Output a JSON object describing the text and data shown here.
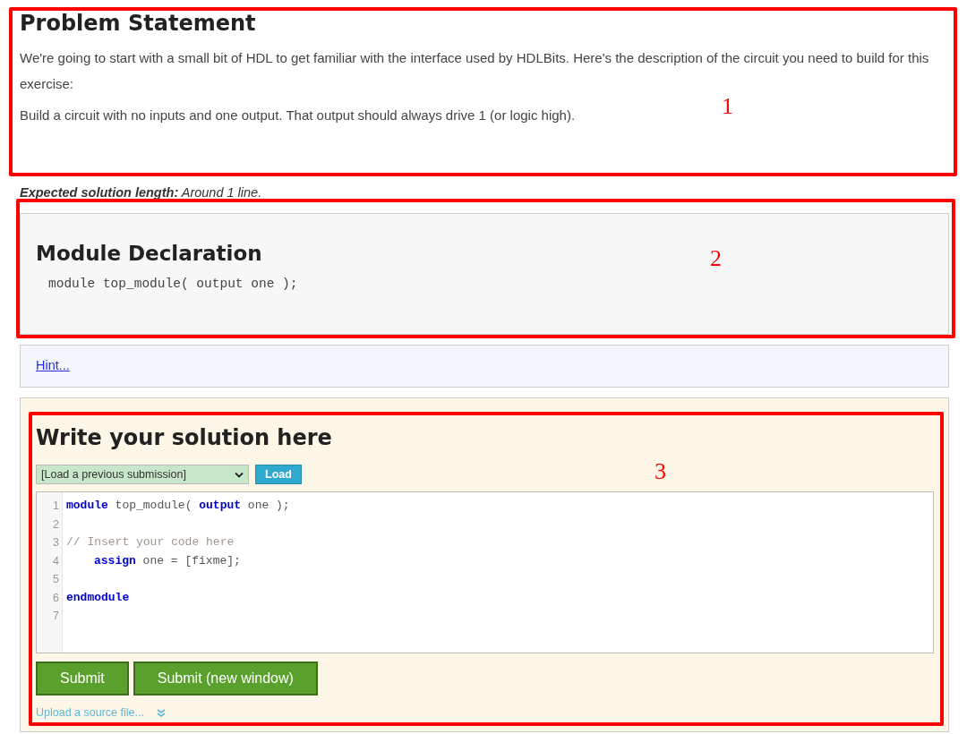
{
  "problem": {
    "title": "Problem Statement",
    "paragraphs": [
      "We're going to start with a small bit of HDL to get familiar with the interface used by HDLBits. Here's the description of the circuit you need to build for this exercise:",
      "Build a circuit with no inputs and one output. That output should always drive 1 (or logic high)."
    ]
  },
  "expected_length": "**Expected solution length:** Around 1 line.",
  "module_declaration": {
    "title": "Module Declaration",
    "code": "module top_module( output one );"
  },
  "hint": {
    "link": "Hint..."
  },
  "solution": {
    "title": "Write your solution here",
    "submission_select": "[Load a previous submission]",
    "load_button": "Load",
    "code_lines": [
      {
        "number": "1",
        "tokens": [
          {
            "kind": "keyword",
            "text": "module"
          },
          {
            "kind": "plain",
            "text": " top_module( "
          },
          {
            "kind": "keyword",
            "text": "output"
          },
          {
            "kind": "plain",
            "text": " one );"
          }
        ]
      },
      {
        "number": "2"
      },
      {
        "number": "3",
        "tokens": [
          {
            "kind": "comment",
            "text": "// Insert your code here"
          }
        ]
      },
      {
        "number": "4",
        "indented": true,
        "tokens": [
          {
            "kind": "keyword",
            "text": "assign"
          },
          {
            "kind": "plain",
            "text": " one = [fixme];"
          }
        ]
      },
      {
        "number": "5"
      },
      {
        "number": "6",
        "tokens": [
          {
            "kind": "keyword",
            "text": "endmodule"
          }
        ]
      },
      {
        "number": "7"
      }
    ],
    "buttons": [
      "Submit",
      "Submit (new window)"
    ],
    "upload_link": "Upload a source file..."
  },
  "annotations": [
    {
      "label": "1"
    },
    {
      "label": "2"
    },
    {
      "label": "3"
    }
  ]
}
